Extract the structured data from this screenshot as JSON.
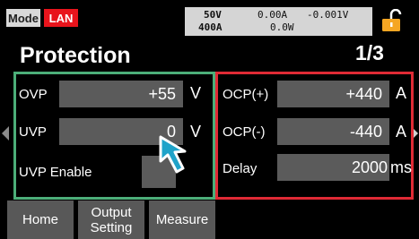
{
  "status": {
    "mode_label": "Mode",
    "lan_label": "LAN",
    "voltage_limit": "50V",
    "current_limit": "400A",
    "measured_current": "0.00A",
    "measured_voltage": "-0.001V",
    "measured_power": "0.0W"
  },
  "header": {
    "title": "Protection",
    "page_counter": "1/3"
  },
  "voltage_group": {
    "ovp": {
      "label": "OVP",
      "value": "+55",
      "unit": "V"
    },
    "uvp": {
      "label": "UVP",
      "value": "0",
      "unit": "V"
    },
    "uvp_enable": {
      "label": "UVP Enable"
    }
  },
  "current_group": {
    "ocp_plus": {
      "label": "OCP(+)",
      "value": "+440",
      "unit": "A"
    },
    "ocp_minus": {
      "label": "OCP(-)",
      "value": "-440",
      "unit": "A"
    },
    "delay": {
      "label": "Delay",
      "value": "2000",
      "unit": "ms"
    }
  },
  "menu": {
    "home": "Home",
    "output_setting_line1": "Output",
    "output_setting_line2": "Setting",
    "measure": "Measure"
  },
  "colors": {
    "voltage_group_border": "#4cae79",
    "current_group_border": "#e02a35",
    "lan_badge": "#e8141c",
    "lock_icon": "#f5a623",
    "cursor": "#1fa3c9"
  }
}
